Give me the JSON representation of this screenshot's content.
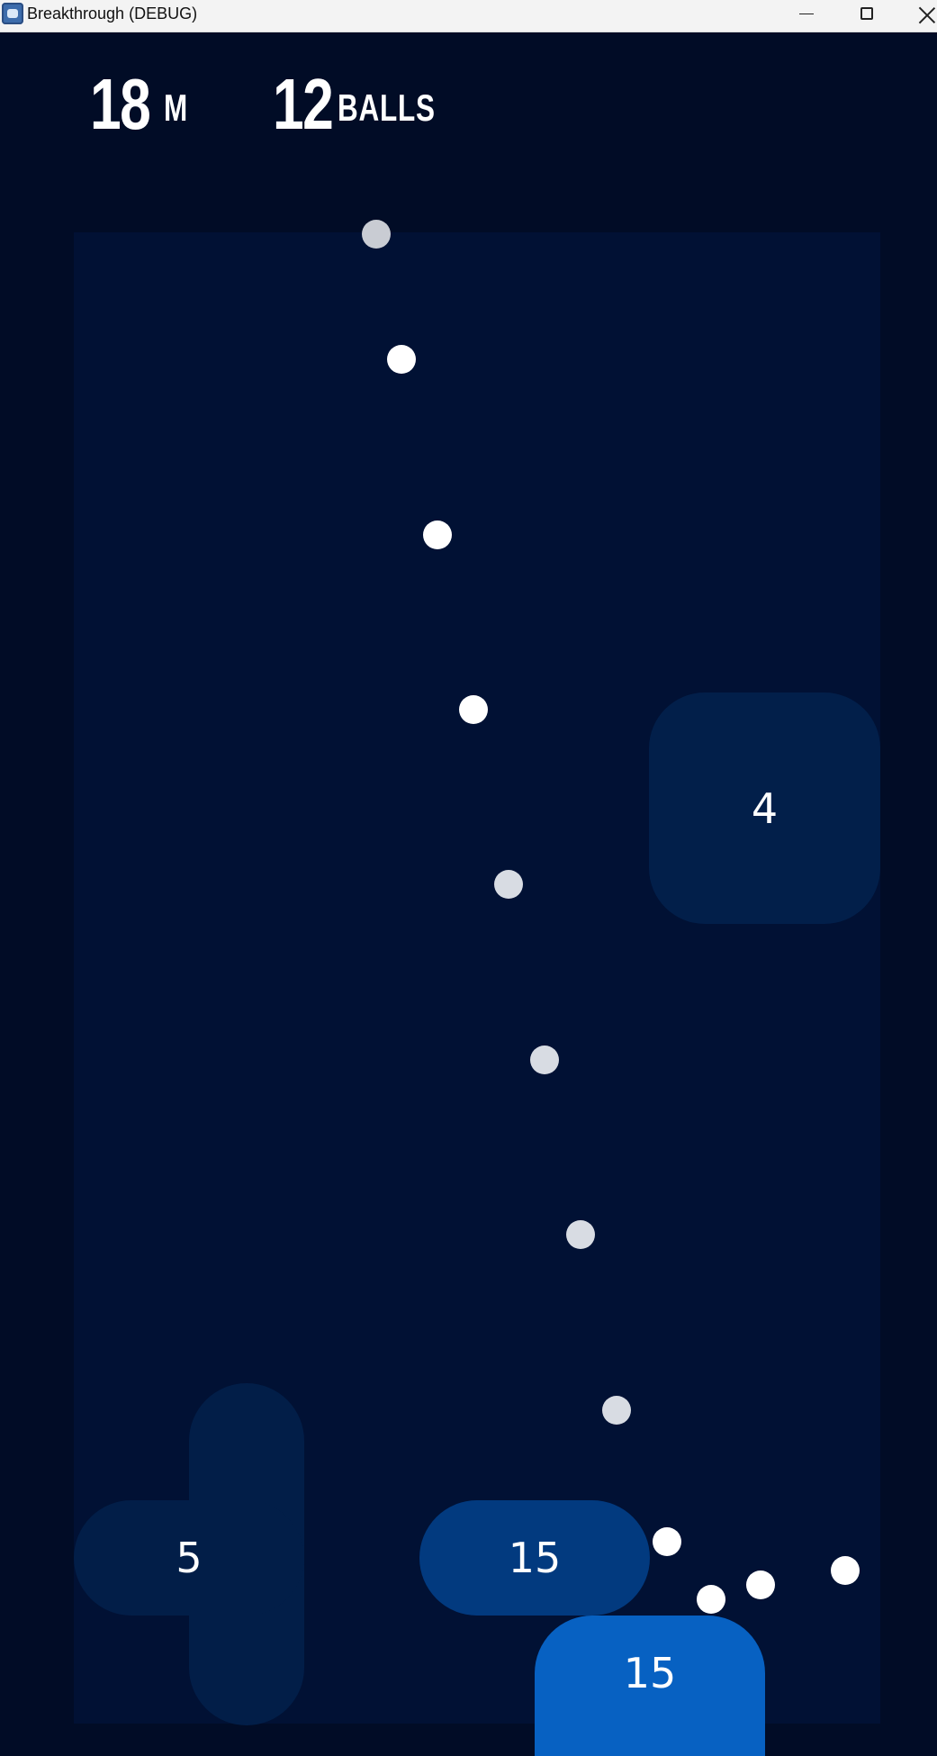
{
  "window": {
    "title": "Breakthrough (DEBUG)",
    "icon": "godot-icon",
    "controls": [
      "minimize-icon",
      "maximize-icon",
      "close-icon"
    ]
  },
  "hud": {
    "distance_value": "18",
    "distance_unit": "M",
    "balls_value": "12",
    "balls_unit": "BALLS"
  },
  "bricks": [
    {
      "label": "4",
      "color": "#021f4a"
    },
    {
      "label": "5",
      "color": "#021e48"
    },
    {
      "label": "15",
      "color": "#023a7f"
    },
    {
      "label": "15",
      "color": "#0761c2"
    }
  ],
  "colors": {
    "background": "#010b22",
    "playfield": "#011134",
    "ball": "#ffffff",
    "hud_text": "#ffffff"
  }
}
